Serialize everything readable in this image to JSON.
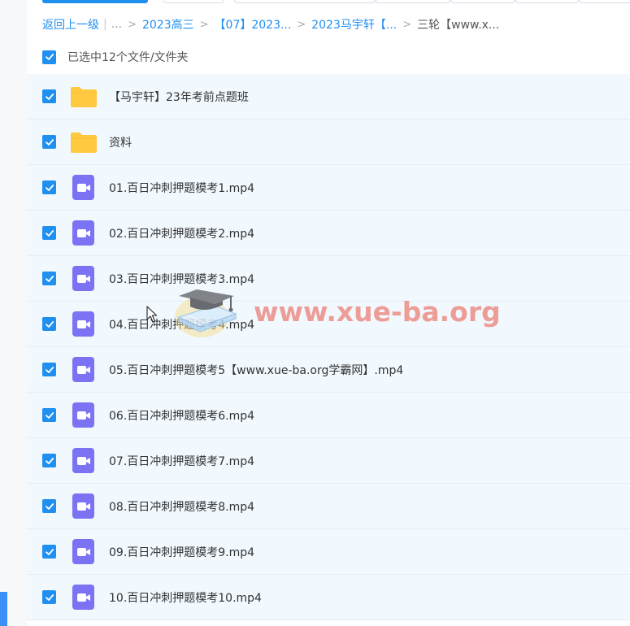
{
  "breadcrumb": {
    "back": "返回上一级",
    "pipe": "|",
    "ellipsis": "...",
    "separator": ">",
    "items": [
      "2023高三",
      "【07】2023...",
      "2023马宇轩【..."
    ],
    "current": "三轮【www.x..."
  },
  "selection": {
    "label": "已选中12个文件/文件夹",
    "checked": true
  },
  "files": [
    {
      "name": "【马宇轩】23年考前点题班",
      "type": "folder",
      "checked": true
    },
    {
      "name": "资料",
      "type": "folder",
      "checked": true
    },
    {
      "name": "01.百日冲刺押题模考1.mp4",
      "type": "video",
      "checked": true
    },
    {
      "name": "02.百日冲刺押题模考2.mp4",
      "type": "video",
      "checked": true
    },
    {
      "name": "03.百日冲刺押题模考3.mp4",
      "type": "video",
      "checked": true
    },
    {
      "name": "04.百日冲刺押题模考4.mp4",
      "type": "video",
      "checked": true
    },
    {
      "name": "05.百日冲刺押题模考5【www.xue-ba.org学霸网】.mp4",
      "type": "video",
      "checked": true
    },
    {
      "name": "06.百日冲刺押题模考6.mp4",
      "type": "video",
      "checked": true
    },
    {
      "name": "07.百日冲刺押题模考7.mp4",
      "type": "video",
      "checked": true
    },
    {
      "name": "08.百日冲刺押题模考8.mp4",
      "type": "video",
      "checked": true
    },
    {
      "name": "09.百日冲刺押题模考9.mp4",
      "type": "video",
      "checked": true
    },
    {
      "name": "10.百日冲刺押题模考10.mp4",
      "type": "video",
      "checked": true
    }
  ],
  "watermark": {
    "text": "www.xue-ba.org",
    "icon": "graduation-cap-book-icon"
  },
  "icons": {
    "folder": "folder-icon",
    "video": "video-file-icon",
    "checkbox": "checkmark-icon"
  },
  "colors": {
    "accent": "#1f8ff0",
    "folder": "#ffc940",
    "video": "#7b73f3",
    "row_bg": "#f1f8fe",
    "watermark": "#ec786e"
  }
}
